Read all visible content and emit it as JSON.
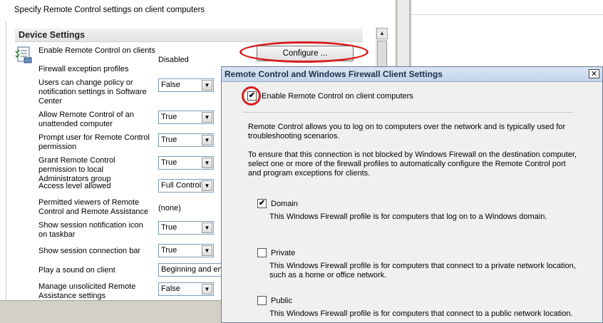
{
  "header": {
    "description": "Specify Remote Control settings on client computers"
  },
  "device_settings": {
    "title": "Device Settings",
    "enable_label": "Enable Remote Control on clients",
    "enable_value": "Disabled",
    "configure_label": "Configure ...",
    "firewall_label": "Firewall exception profiles",
    "rows": [
      {
        "label": "Users can change policy or notification settings in Software Center",
        "value": "False"
      },
      {
        "label": "Allow Remote Control of an unattended computer",
        "value": "True"
      },
      {
        "label": "Prompt user for Remote Control permission",
        "value": "True"
      },
      {
        "label": "Grant Remote Control permission to local Administrators group",
        "value": "True"
      },
      {
        "label": "Access level allowed",
        "value": "Full Control"
      },
      {
        "label": "Permitted viewers of Remote Control and Remote Assistance",
        "value": "(none)"
      },
      {
        "label": "Show session notification icon on taskbar",
        "value": "True"
      },
      {
        "label": "Show session connection bar",
        "value": "True"
      },
      {
        "label": "Play a sound on client",
        "value": "Beginning and end"
      },
      {
        "label": "Manage unsolicited Remote Assistance settings",
        "value": "False"
      }
    ]
  },
  "dialog": {
    "title": "Remote Control and Windows Firewall Client Settings",
    "close_label": "✕",
    "enable_checkbox_label": "Enable Remote Control on client computers",
    "enable_checked": true,
    "desc1": "Remote Control allows you to log on to computers over the network and is typically used for troubleshooting scenarios.",
    "desc2": "To ensure that this connection is not blocked by Windows Firewall on the destination computer, select one or more of the firewall profiles to automatically configure the Remote Control port and program exceptions for clients.",
    "profiles": [
      {
        "name": "Domain",
        "checked": true,
        "desc": "This Windows Firewall profile is for computers that log on to a Windows domain."
      },
      {
        "name": "Private",
        "checked": false,
        "desc": "This Windows Firewall profile is for computers that connect to a private network location, such as a home or office network."
      },
      {
        "name": "Public",
        "checked": false,
        "desc": "This Windows Firewall profile is for computers that connect to a public network location."
      }
    ]
  },
  "icons": {
    "check": "✔",
    "scroll_up": "▲",
    "dropdown": "▼"
  },
  "colors": {
    "highlight_ring": "#d81e1e",
    "title_text": "#1f2f4a"
  }
}
